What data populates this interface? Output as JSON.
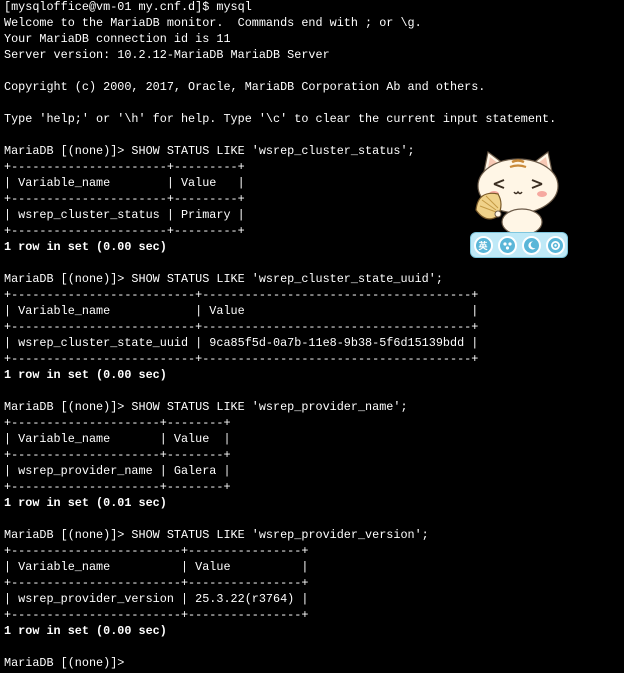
{
  "terminal": {
    "lines": [
      "[mysqloffice@vm-01 my.cnf.d]$ mysql",
      "Welcome to the MariaDB monitor.  Commands end with ; or \\g.",
      "Your MariaDB connection id is 11",
      "Server version: 10.2.12-MariaDB MariaDB Server",
      "",
      "Copyright (c) 2000, 2017, Oracle, MariaDB Corporation Ab and others.",
      "",
      "Type 'help;' or '\\h' for help. Type '\\c' to clear the current input statement.",
      "",
      "MariaDB [(none)]> SHOW STATUS LIKE 'wsrep_cluster_status';",
      "+----------------------+---------+",
      "| Variable_name        | Value   |",
      "+----------------------+---------+",
      "| wsrep_cluster_status | Primary |",
      "+----------------------+---------+",
      "1 row in set (0.00 sec)",
      "",
      "MariaDB [(none)]> SHOW STATUS LIKE 'wsrep_cluster_state_uuid';",
      "+--------------------------+--------------------------------------+",
      "| Variable_name            | Value                                |",
      "+--------------------------+--------------------------------------+",
      "| wsrep_cluster_state_uuid | 9ca85f5d-0a7b-11e8-9b38-5f6d15139bdd |",
      "+--------------------------+--------------------------------------+",
      "1 row in set (0.00 sec)",
      "",
      "MariaDB [(none)]> SHOW STATUS LIKE 'wsrep_provider_name';",
      "+---------------------+--------+",
      "| Variable_name       | Value  |",
      "+---------------------+--------+",
      "| wsrep_provider_name | Galera |",
      "+---------------------+--------+",
      "1 row in set (0.01 sec)",
      "",
      "MariaDB [(none)]> SHOW STATUS LIKE 'wsrep_provider_version';",
      "+------------------------+----------------+",
      "| Variable_name          | Value          |",
      "+------------------------+----------------+",
      "| wsrep_provider_version | 25.3.22(r3764) |",
      "+------------------------+----------------+",
      "1 row in set (0.00 sec)",
      "",
      "MariaDB [(none)]> "
    ]
  },
  "ime_toolbar": {
    "mode_label": "英",
    "icons": [
      "mascot-cat-icon",
      "language-mode-icon",
      "dots-icon",
      "moon-icon",
      "settings-icon"
    ]
  },
  "colors": {
    "background": "#000000",
    "text": "#ffffff",
    "toolbar_bg": "#bfe9f7",
    "toolbar_button": "#5ab6d8"
  }
}
